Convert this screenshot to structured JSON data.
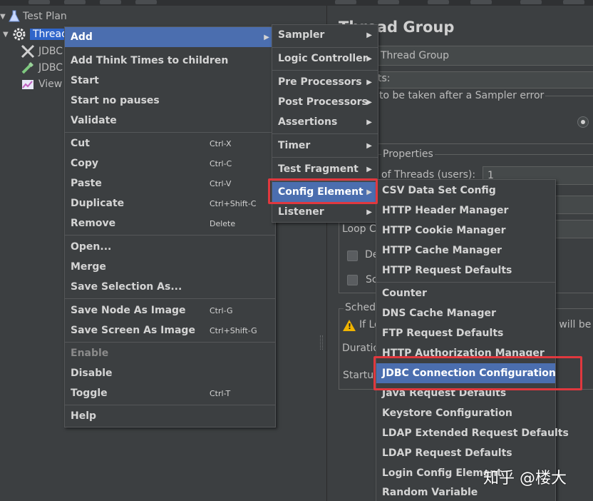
{
  "tree": {
    "items": [
      {
        "label": "Test Plan",
        "icon": "flask-icon"
      },
      {
        "label": "Thread",
        "icon": "gear-icon"
      },
      {
        "label": "JDBC",
        "icon": "tools-icon"
      },
      {
        "label": "JDBC",
        "icon": "dropper-icon"
      },
      {
        "label": "View",
        "icon": "graph-icon"
      }
    ]
  },
  "right_panel": {
    "title": "Thread Group",
    "name_value": "Thread Group",
    "comments_label": "ts:",
    "error_action_label": "to be taken after a Sampler error",
    "properties_label": "Properties",
    "threads_label": "of Threads (users):",
    "threads_value": "1",
    "loop_label": "Loop C",
    "delay_label": "De",
    "same_user_label": "Sc",
    "scheduler_label": "Sched",
    "warning_prefix": "If Lo",
    "warning_suffix": "n will be",
    "duration_label": "Duratio",
    "startup_label": "Startu"
  },
  "context_menu": {
    "add": "Add",
    "add_think_times": "Add Think Times to children",
    "start": "Start",
    "start_no_pauses": "Start no pauses",
    "validate": "Validate",
    "cut": "Cut",
    "cut_sc": "Ctrl-X",
    "copy": "Copy",
    "copy_sc": "Ctrl-C",
    "paste": "Paste",
    "paste_sc": "Ctrl-V",
    "duplicate": "Duplicate",
    "duplicate_sc": "Ctrl+Shift-C",
    "remove": "Remove",
    "remove_sc": "Delete",
    "open": "Open...",
    "merge": "Merge",
    "save_selection": "Save Selection As...",
    "save_node_image": "Save Node As Image",
    "save_node_image_sc": "Ctrl-G",
    "save_screen_image": "Save Screen As Image",
    "save_screen_image_sc": "Ctrl+Shift-G",
    "enable": "Enable",
    "disable": "Disable",
    "toggle": "Toggle",
    "toggle_sc": "Ctrl-T",
    "help": "Help"
  },
  "add_submenu": {
    "sampler": "Sampler",
    "logic_controller": "Logic Controller",
    "pre_processors": "Pre Processors",
    "post_processors": "Post Processors",
    "assertions": "Assertions",
    "timer": "Timer",
    "test_fragment": "Test Fragment",
    "config_element": "Config Element",
    "listener": "Listener"
  },
  "config_submenu": {
    "items_group1": [
      "CSV Data Set Config",
      "HTTP Header Manager",
      "HTTP Cookie Manager",
      "HTTP Cache Manager",
      "HTTP Request Defaults"
    ],
    "items_group2": [
      "Counter",
      "DNS Cache Manager",
      "FTP Request Defaults",
      "HTTP Authorization Manager",
      "JDBC Connection Configuration",
      "Java Request Defaults",
      "Keystore Configuration",
      "LDAP Extended Request Defaults",
      "LDAP Request Defaults",
      "Login Config Element",
      "Random Variable"
    ]
  },
  "watermark": "知乎 @楼大",
  "colors": {
    "highlight": "#4b6eaf",
    "selection": "#2f65ca",
    "annotation_box": "#e0383e",
    "background": "#3c3f41"
  }
}
